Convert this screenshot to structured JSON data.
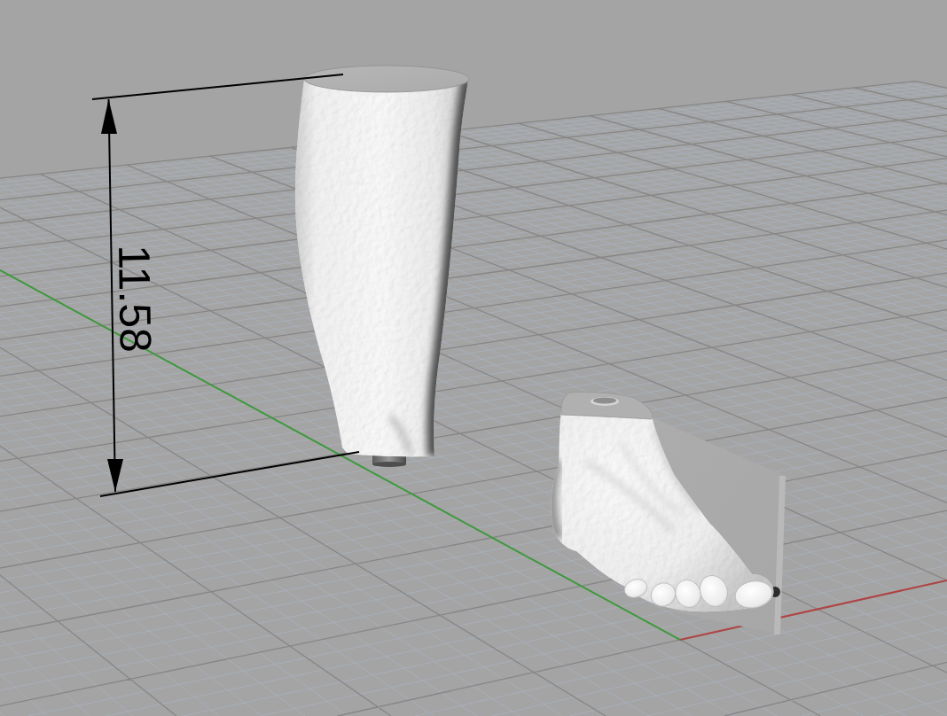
{
  "viewport": {
    "dimension": {
      "label": "11.58"
    }
  }
}
